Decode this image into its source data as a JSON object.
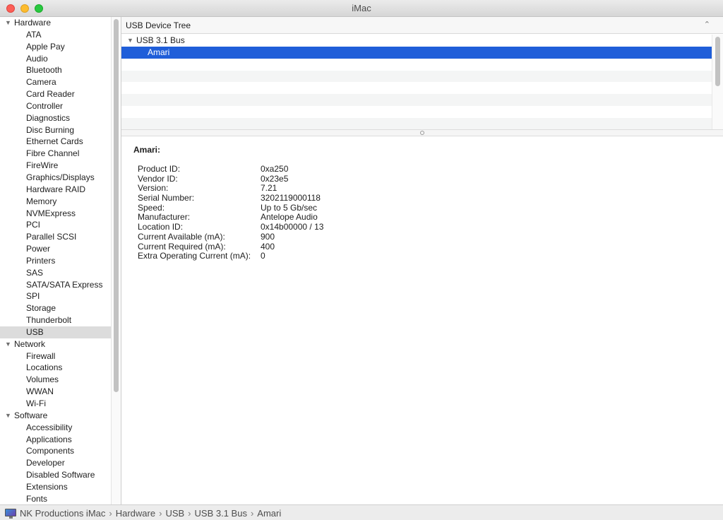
{
  "window": {
    "title": "iMac"
  },
  "sidebar": {
    "categories": [
      {
        "label": "Hardware",
        "items": [
          "ATA",
          "Apple Pay",
          "Audio",
          "Bluetooth",
          "Camera",
          "Card Reader",
          "Controller",
          "Diagnostics",
          "Disc Burning",
          "Ethernet Cards",
          "Fibre Channel",
          "FireWire",
          "Graphics/Displays",
          "Hardware RAID",
          "Memory",
          "NVMExpress",
          "PCI",
          "Parallel SCSI",
          "Power",
          "Printers",
          "SAS",
          "SATA/SATA Express",
          "SPI",
          "Storage",
          "Thunderbolt",
          "USB"
        ]
      },
      {
        "label": "Network",
        "items": [
          "Firewall",
          "Locations",
          "Volumes",
          "WWAN",
          "Wi-Fi"
        ]
      },
      {
        "label": "Software",
        "items": [
          "Accessibility",
          "Applications",
          "Components",
          "Developer",
          "Disabled Software",
          "Extensions",
          "Fonts"
        ]
      }
    ],
    "selected": "USB"
  },
  "tree": {
    "header": "USB Device Tree",
    "bus": "USB 3.1 Bus",
    "device": "Amari"
  },
  "detail": {
    "title": "Amari:",
    "properties": [
      {
        "key": "Product ID:",
        "value": "0xa250"
      },
      {
        "key": "Vendor ID:",
        "value": "0x23e5"
      },
      {
        "key": "Version:",
        "value": "7.21"
      },
      {
        "key": "Serial Number:",
        "value": "3202119000118"
      },
      {
        "key": "Speed:",
        "value": "Up to 5 Gb/sec"
      },
      {
        "key": "Manufacturer:",
        "value": "Antelope Audio"
      },
      {
        "key": "Location ID:",
        "value": "0x14b00000 / 13"
      },
      {
        "key": "Current Available (mA):",
        "value": "900"
      },
      {
        "key": "Current Required (mA):",
        "value": "400"
      },
      {
        "key": "Extra Operating Current (mA):",
        "value": "0"
      }
    ]
  },
  "statusbar": {
    "icon": "imac-icon",
    "breadcrumb": [
      "NK Productions iMac",
      "Hardware",
      "USB",
      "USB 3.1 Bus",
      "Amari"
    ],
    "separator": "›"
  }
}
